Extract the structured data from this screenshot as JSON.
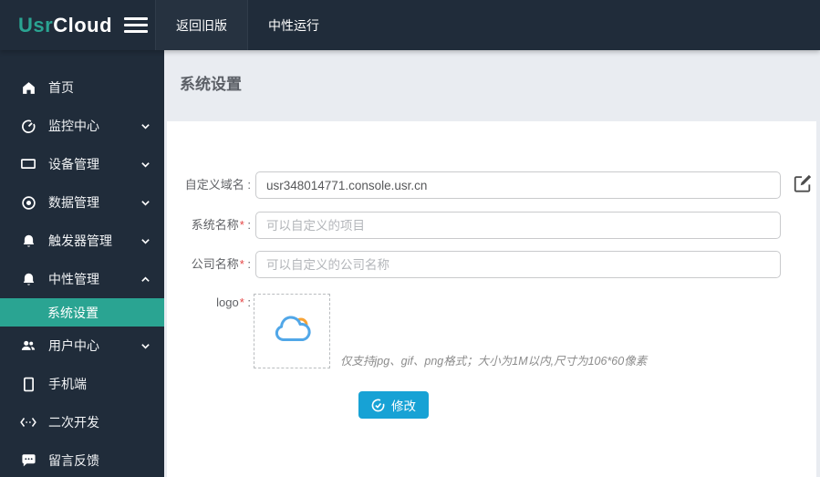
{
  "header": {
    "logo": {
      "part1": "Usr",
      "part2": "Cloud"
    },
    "menu_icon": "hamburger-icon",
    "tabs": [
      {
        "label": "返回旧版"
      },
      {
        "label": "中性运行"
      }
    ]
  },
  "sidebar": {
    "items": [
      {
        "label": "首页",
        "icon": "home-icon"
      },
      {
        "label": "监控中心",
        "icon": "gauge-icon",
        "chevron": "down"
      },
      {
        "label": "设备管理",
        "icon": "monitor-icon",
        "chevron": "down"
      },
      {
        "label": "数据管理",
        "icon": "disc-icon",
        "chevron": "down"
      },
      {
        "label": "触发器管理",
        "icon": "bell-icon",
        "chevron": "down"
      },
      {
        "label": "中性管理",
        "icon": "bell-icon",
        "chevron": "up",
        "expanded": true
      },
      {
        "label": "用户中心",
        "icon": "users-icon",
        "chevron": "down"
      },
      {
        "label": "手机端",
        "icon": "phone-icon"
      },
      {
        "label": "二次开发",
        "icon": "code-icon"
      },
      {
        "label": "留言反馈",
        "icon": "feedback-icon"
      }
    ],
    "submenu": {
      "label": "系统设置",
      "active": true
    }
  },
  "main": {
    "title": "系统设置",
    "form": {
      "required_mark": "*",
      "colon": " :",
      "fields": [
        {
          "label": "自定义域名",
          "required": false,
          "value": "usr348014771.console.usr.cn",
          "edit_icon": "edit-icon"
        },
        {
          "label": "系统名称",
          "required": true,
          "placeholder": "可以自定义的项目"
        },
        {
          "label": "公司名称",
          "required": true,
          "placeholder": "可以自定义的公司名称"
        },
        {
          "label": "logo",
          "required": true,
          "upload_icon": "cloud-upload-icon"
        }
      ],
      "logo_note": "仅支持jpg、gif、png格式；大小为1M以内,尺寸为106*60像素",
      "submit": {
        "label": "修改",
        "icon": "check-circle-icon"
      }
    }
  },
  "colors": {
    "header_bg": "#202c3a",
    "accent_teal": "#2aa492",
    "button_blue": "#17a2d5",
    "page_bg": "#e9ecf1",
    "required_red": "#e64545",
    "cloud_blue": "#51a7e8",
    "cloud_orange": "#f7a335"
  }
}
